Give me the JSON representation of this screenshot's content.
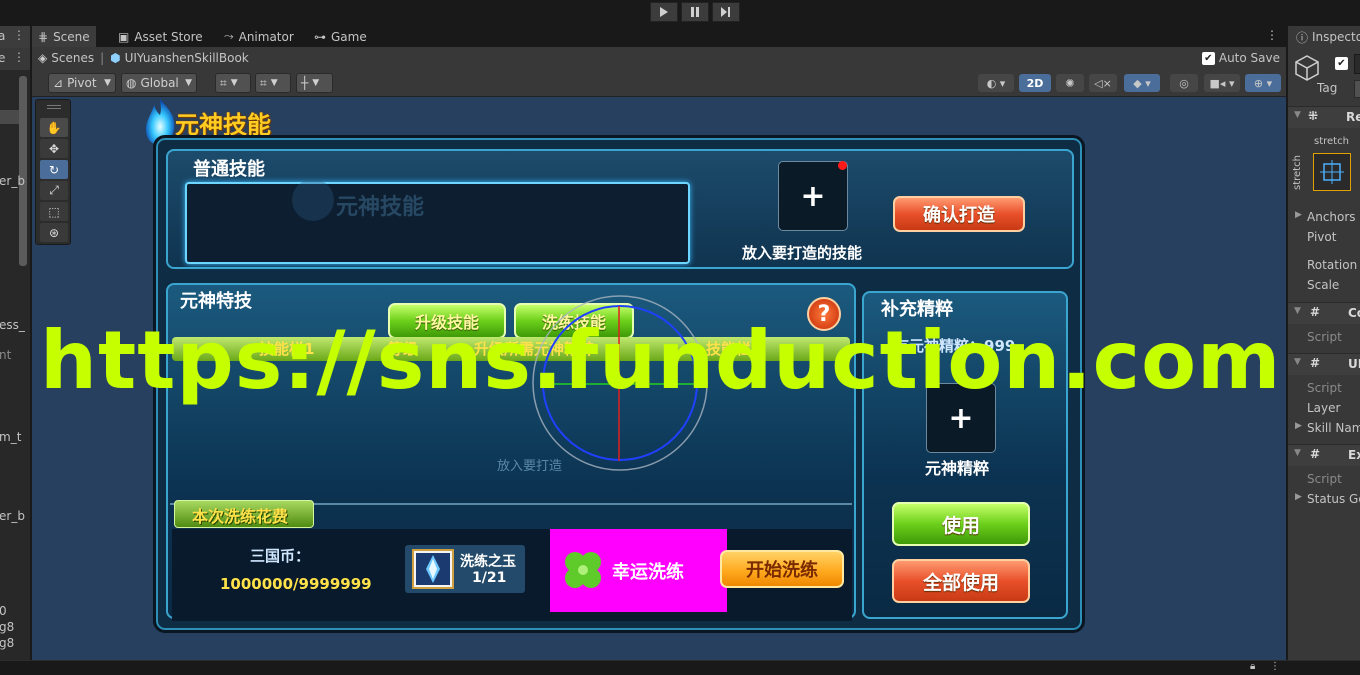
{
  "toolbar": {
    "play_icon": "play-icon",
    "pause_icon": "pause-icon",
    "step_icon": "step-icon"
  },
  "hierarchy": {
    "fragments": [
      "a",
      "e",
      "er_b",
      "ess_",
      "nt",
      "m_t",
      "er_b",
      "0",
      "g8",
      "g8"
    ]
  },
  "tabs": [
    {
      "label": "Scene",
      "icon": "grid-icon",
      "active": true
    },
    {
      "label": "Asset Store",
      "icon": "bag-icon"
    },
    {
      "label": "Animator",
      "icon": "animator-icon"
    },
    {
      "label": "Game",
      "icon": "gamepad-icon"
    }
  ],
  "breadcrumb": {
    "root": "Scenes",
    "current": "UIYuanshenSkillBook",
    "autosave_label": "Auto Save",
    "autosave_checked": true
  },
  "scene_tools": {
    "pivot": "Pivot",
    "global": "Global",
    "mode_2d": "2D"
  },
  "inspector": {
    "title": "Inspecto",
    "tag_label": "Tag",
    "rect_header": "Re",
    "stretch_label": "stretch",
    "rows": [
      "Anchors",
      "Pivot",
      "Rotation",
      "Scale"
    ],
    "components": [
      {
        "header": "Co",
        "rows": [
          "Script"
        ]
      },
      {
        "header": "UI",
        "rows": [
          "Script",
          "Layer",
          "Skill Name"
        ]
      },
      {
        "header": "Ex",
        "rows": [
          "Script",
          "Status Go"
        ]
      }
    ]
  },
  "game": {
    "title": "元神技能",
    "ghost_title": "元神技能",
    "normal_skill": {
      "header": "普通技能",
      "slot_caption": "放入要打造的技能",
      "confirm_button": "确认打造"
    },
    "special": {
      "header": "元神特技",
      "tab_upgrade": "升级技能",
      "tab_refine": "洗练技能",
      "columns": [
        "技能栏1",
        "等级",
        "升级所需元神精粹",
        "技能栏3"
      ],
      "slot_caption": "放入要打造"
    },
    "cost": {
      "header": "本次洗练花费",
      "coin_label": "三国币：",
      "coin_value": "1000000/9999999",
      "jade_name": "洗练之玉",
      "jade_count": "1/21",
      "lucky_label": "幸运洗练",
      "start_button": "开始洗练"
    },
    "supplement": {
      "header": "补充精粹",
      "owned_label": "有元神精粹：999",
      "slot_caption": "元神精粹",
      "use_button": "使用",
      "use_all_button": "全部使用"
    }
  },
  "watermark": "https://sns.funduction.com",
  "colors": {
    "scene_bg": "#28405f",
    "watermark": "#c6ff00",
    "magenta": "#ff00ff",
    "gold_text": "#ffe24a"
  }
}
